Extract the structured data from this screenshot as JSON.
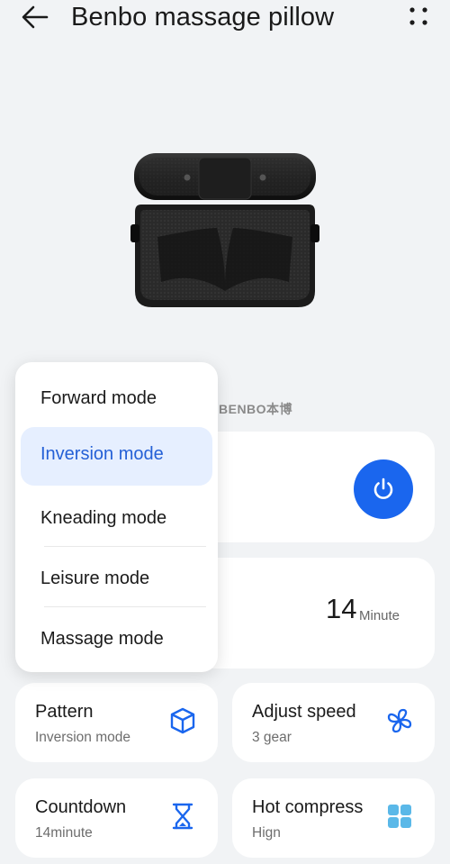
{
  "header": {
    "title": "Benbo massage pillow",
    "back_icon": "arrow-left-icon",
    "more_icon": "more-dots-icon"
  },
  "product": {
    "brand": "BENBO本博"
  },
  "power": {
    "icon": "power-icon",
    "color": "#1a66ee"
  },
  "timer": {
    "value": "14",
    "unit": "Minute"
  },
  "tiles": [
    {
      "label": "Pattern",
      "value": "Inversion mode",
      "icon": "cube-icon"
    },
    {
      "label": "Adjust speed",
      "value": "3 gear",
      "icon": "fan-icon"
    },
    {
      "label": "Countdown",
      "value": "14minute",
      "icon": "hourglass-icon"
    },
    {
      "label": "Hot compress",
      "value": "Hign",
      "icon": "grid-squares-icon"
    }
  ],
  "mode_menu": {
    "items": [
      {
        "label": "Forward mode"
      },
      {
        "label": "Inversion mode",
        "selected": true
      },
      {
        "label": "Kneading mode"
      },
      {
        "label": "Leisure mode"
      },
      {
        "label": "Massage mode"
      }
    ]
  },
  "colors": {
    "accent": "#1a66ee",
    "background": "#f1f3f5",
    "selected_bg": "#e6efff"
  }
}
